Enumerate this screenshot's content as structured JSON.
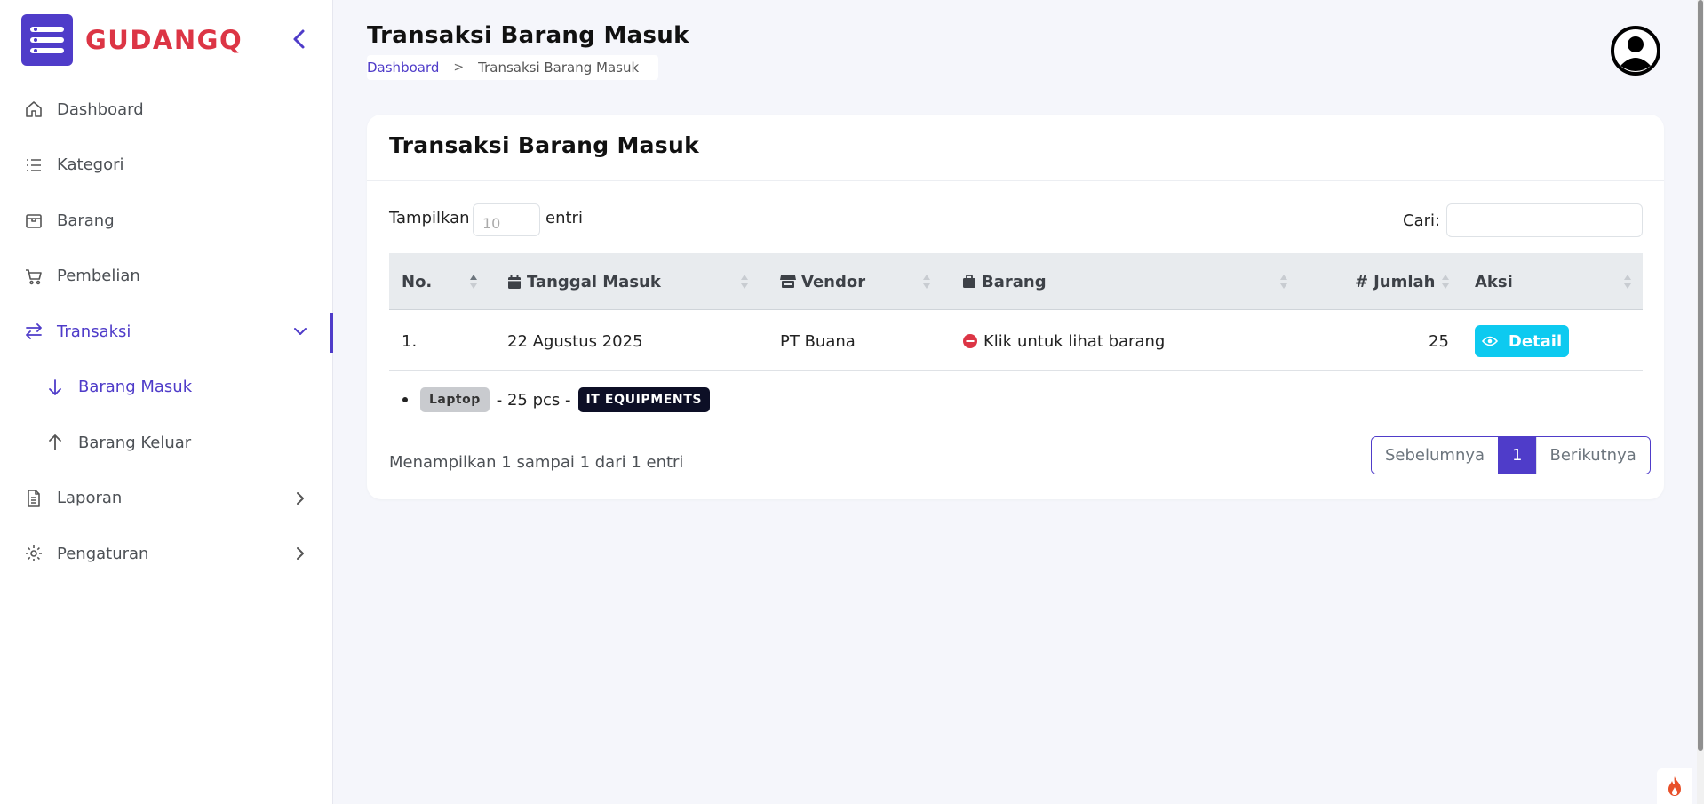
{
  "brand": {
    "name": "GUDANGQ"
  },
  "sidebar": {
    "items": [
      {
        "label": "Dashboard",
        "icon": "home-icon"
      },
      {
        "label": "Kategori",
        "icon": "list-icon"
      },
      {
        "label": "Barang",
        "icon": "box-icon"
      },
      {
        "label": "Pembelian",
        "icon": "cart-icon"
      },
      {
        "label": "Transaksi",
        "icon": "transfer-icon",
        "expanded": true,
        "children": [
          {
            "label": "Barang Masuk",
            "icon": "arrow-down-icon",
            "current": true
          },
          {
            "label": "Barang Keluar",
            "icon": "arrow-up-icon"
          }
        ]
      },
      {
        "label": "Laporan",
        "icon": "document-icon"
      },
      {
        "label": "Pengaturan",
        "icon": "gear-icon"
      }
    ]
  },
  "header": {
    "title": "Transaksi Barang Masuk",
    "breadcrumb": {
      "link": "Dashboard",
      "separator": ">",
      "current": "Transaksi Barang Masuk"
    }
  },
  "card": {
    "title": "Transaksi Barang Masuk",
    "length": {
      "prefix": "Tampilkan",
      "value": "10",
      "suffix": "entri"
    },
    "search": {
      "label": "Cari:",
      "value": ""
    },
    "columns": [
      "No.",
      "Tanggal Masuk",
      "Vendor",
      "Barang",
      "Jumlah",
      "Aksi"
    ],
    "column_prefix": {
      "jumlah": "#"
    },
    "rows": [
      {
        "no": "1.",
        "tanggal": "22 Agustus 2025",
        "vendor": "PT Buana",
        "barang": "Klik untuk lihat barang",
        "jumlah": "25",
        "aksi": "Detail"
      }
    ],
    "child_items": [
      {
        "name": "Laptop",
        "qty_text": "- 25 pcs -",
        "category": "IT EQUIPMENTS"
      }
    ],
    "info": "Menampilkan 1 sampai 1 dari 1 entri",
    "pagination": {
      "prev": "Sebelumnya",
      "page": "1",
      "next": "Berikutnya"
    }
  },
  "colors": {
    "primary": "#4f3cc9",
    "brand_red": "#dc3545",
    "info": "#0dcaf0",
    "badge_dark": "#0d0f26",
    "badge_gray": "#c9cbcf"
  }
}
